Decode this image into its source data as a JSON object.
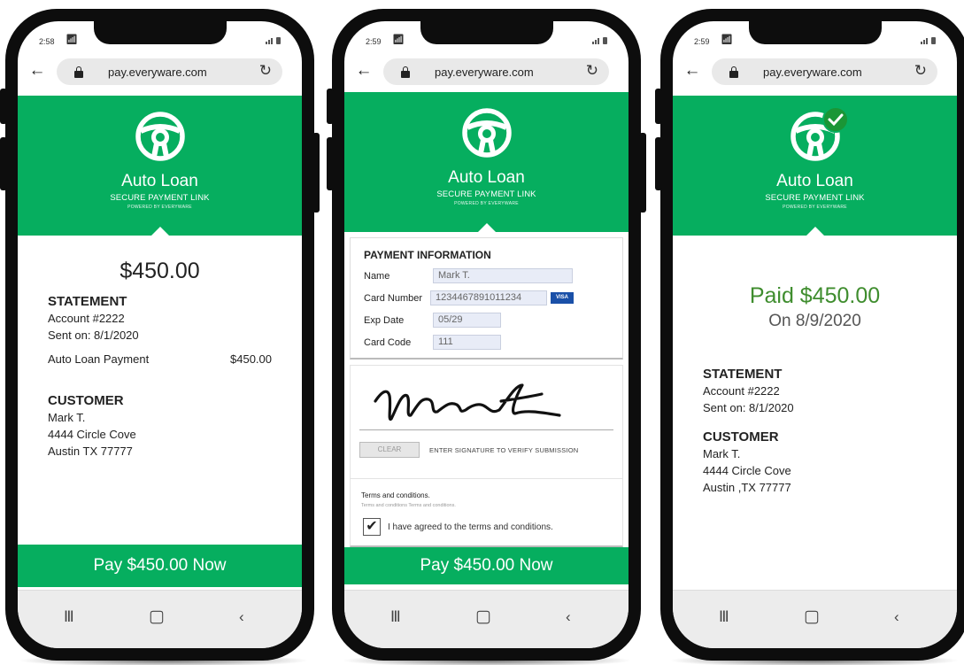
{
  "device": {
    "url": "pay.everyware.com"
  },
  "screens": [
    {
      "time": "2:58"
    },
    {
      "time": "2:59"
    },
    {
      "time": "2:59"
    }
  ],
  "header": {
    "title": "Auto Loan",
    "subtitle": "SECURE PAYMENT LINK",
    "powered": "POWERED BY EVERYWARE"
  },
  "screen1": {
    "amount": "$450.00",
    "statement": {
      "heading": "STATEMENT",
      "account": "Account #2222",
      "sent": "Sent on: 8/1/2020",
      "line_label": "Auto Loan Payment",
      "line_amount": "$450.00"
    },
    "customer": {
      "heading": "CUSTOMER",
      "name": "Mark T.",
      "street": "4444 Circle Cove",
      "city": "Austin TX 77777"
    },
    "pay_button": "Pay $450.00 Now"
  },
  "screen2": {
    "form": {
      "title": "PAYMENT INFORMATION",
      "name_label": "Name",
      "name_value": "Mark T.",
      "card_label": "Card Number",
      "card_value": "1234467891011234",
      "card_brand": "VISA",
      "exp_label": "Exp Date",
      "exp_value": "05/29",
      "code_label": "Card Code",
      "code_value": "111"
    },
    "signature": {
      "clear": "CLEAR",
      "hint": "ENTER SIGNATURE TO VERIFY SUBMISSION"
    },
    "terms": {
      "title": "Terms and conditions.",
      "subtitle": "Terms and conditions Terms and conditions.",
      "agree": "I have agreed to the terms and conditions.",
      "checked": true
    },
    "pay_button": "Pay $450.00 Now"
  },
  "screen3": {
    "paid": "Paid $450.00",
    "paid_on": "On 8/9/2020",
    "statement": {
      "heading": "STATEMENT",
      "account": "Account #2222",
      "sent": "Sent on: 8/1/2020"
    },
    "customer": {
      "heading": "CUSTOMER",
      "name": "Mark T.",
      "street": "4444 Circle Cove",
      "city": "Austin ,TX 77777"
    }
  },
  "icons": [
    "steering-wheel-icon",
    "lock-icon",
    "back-arrow-icon",
    "reload-icon",
    "wifi-icon",
    "signal-icon",
    "battery-icon",
    "checkmark-badge-icon"
  ],
  "colors": {
    "brand_green": "#06ae5f",
    "paid_green": "#3f8d2e",
    "visa_blue": "#1a50a8"
  }
}
